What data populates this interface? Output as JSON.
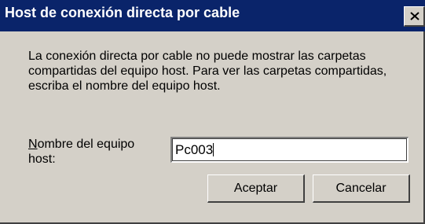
{
  "window": {
    "title": "Host de conexión directa por cable"
  },
  "titlebar": {
    "close_icon": "close-icon"
  },
  "message": {
    "text": "La conexión directa por cable no puede mostrar las carpetas compartidas del equipo host. Para ver las carpetas compartidas, escriba el nombre del equipo host."
  },
  "host_field": {
    "label_accel": "N",
    "label_rest": "ombre del equipo host:",
    "value": "Pc003"
  },
  "buttons": {
    "ok_label": "Aceptar",
    "cancel_label": "Cancelar"
  },
  "colors": {
    "titlebar": "#0a246a",
    "face": "#d4d0c8"
  }
}
